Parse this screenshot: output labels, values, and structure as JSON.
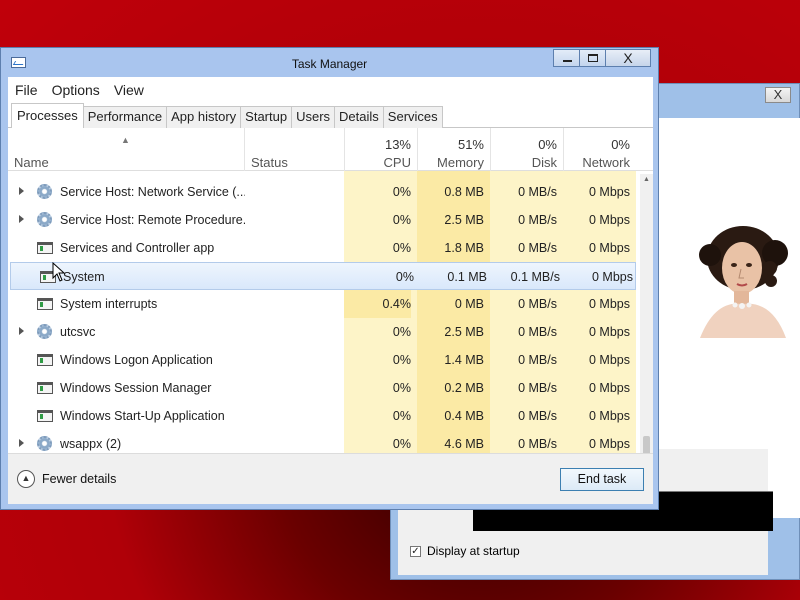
{
  "background_window": {
    "close_glyph": "X",
    "display_at_startup_label": "Display at startup",
    "display_at_startup_checked": true
  },
  "window": {
    "title": "Task Manager",
    "close_glyph": "X"
  },
  "menu": [
    "File",
    "Options",
    "View"
  ],
  "tabs": [
    "Processes",
    "Performance",
    "App history",
    "Startup",
    "Users",
    "Details",
    "Services"
  ],
  "active_tab": "Processes",
  "columns": {
    "name": "Name",
    "status": "Status",
    "cpu": {
      "pct": "13%",
      "label": "CPU"
    },
    "memory": {
      "pct": "51%",
      "label": "Memory"
    },
    "disk": {
      "pct": "0%",
      "label": "Disk"
    },
    "network": {
      "pct": "0%",
      "label": "Network"
    }
  },
  "rows": [
    {
      "expandable": true,
      "icon": "gear-icon",
      "name": "Service Host: Network Service (...",
      "cpu": "0%",
      "memory": "0.8 MB",
      "disk": "0 MB/s",
      "network": "0 Mbps"
    },
    {
      "expandable": true,
      "icon": "gear-icon",
      "name": "Service Host: Remote Procedure...",
      "cpu": "0%",
      "memory": "2.5 MB",
      "disk": "0 MB/s",
      "network": "0 Mbps"
    },
    {
      "expandable": false,
      "icon": "window-icon",
      "name": "Services and Controller app",
      "cpu": "0%",
      "memory": "1.8 MB",
      "disk": "0 MB/s",
      "network": "0 Mbps"
    },
    {
      "expandable": false,
      "icon": "window-icon",
      "name": "System",
      "cpu": "0%",
      "memory": "0.1 MB",
      "disk": "0.1 MB/s",
      "network": "0 Mbps",
      "selected": true
    },
    {
      "expandable": false,
      "icon": "window-icon",
      "name": "System interrupts",
      "cpu": "0.4%",
      "memory": "0 MB",
      "disk": "0 MB/s",
      "network": "0 Mbps"
    },
    {
      "expandable": true,
      "icon": "gear-icon",
      "name": "utcsvc",
      "cpu": "0%",
      "memory": "2.5 MB",
      "disk": "0 MB/s",
      "network": "0 Mbps"
    },
    {
      "expandable": false,
      "icon": "window-icon",
      "name": "Windows Logon Application",
      "cpu": "0%",
      "memory": "1.4 MB",
      "disk": "0 MB/s",
      "network": "0 Mbps"
    },
    {
      "expandable": false,
      "icon": "window-icon",
      "name": "Windows Session Manager",
      "cpu": "0%",
      "memory": "0.2 MB",
      "disk": "0 MB/s",
      "network": "0 Mbps"
    },
    {
      "expandable": false,
      "icon": "window-icon",
      "name": "Windows Start-Up Application",
      "cpu": "0%",
      "memory": "0.4 MB",
      "disk": "0 MB/s",
      "network": "0 Mbps"
    },
    {
      "expandable": true,
      "icon": "gear-icon",
      "name": "wsappx (2)",
      "cpu": "0%",
      "memory": "4.6 MB",
      "disk": "0 MB/s",
      "network": "0 Mbps"
    }
  ],
  "footer": {
    "fewer_details_label": "Fewer details",
    "end_task_label": "End task"
  },
  "colors": {
    "cpu_heat": "#fdf4c8",
    "cpu_heat_high": "#fbeaa5",
    "memory_heat": "#fbeaa5",
    "selected_row": "#d9e8fb",
    "title_bar": "#a9c5ee"
  }
}
